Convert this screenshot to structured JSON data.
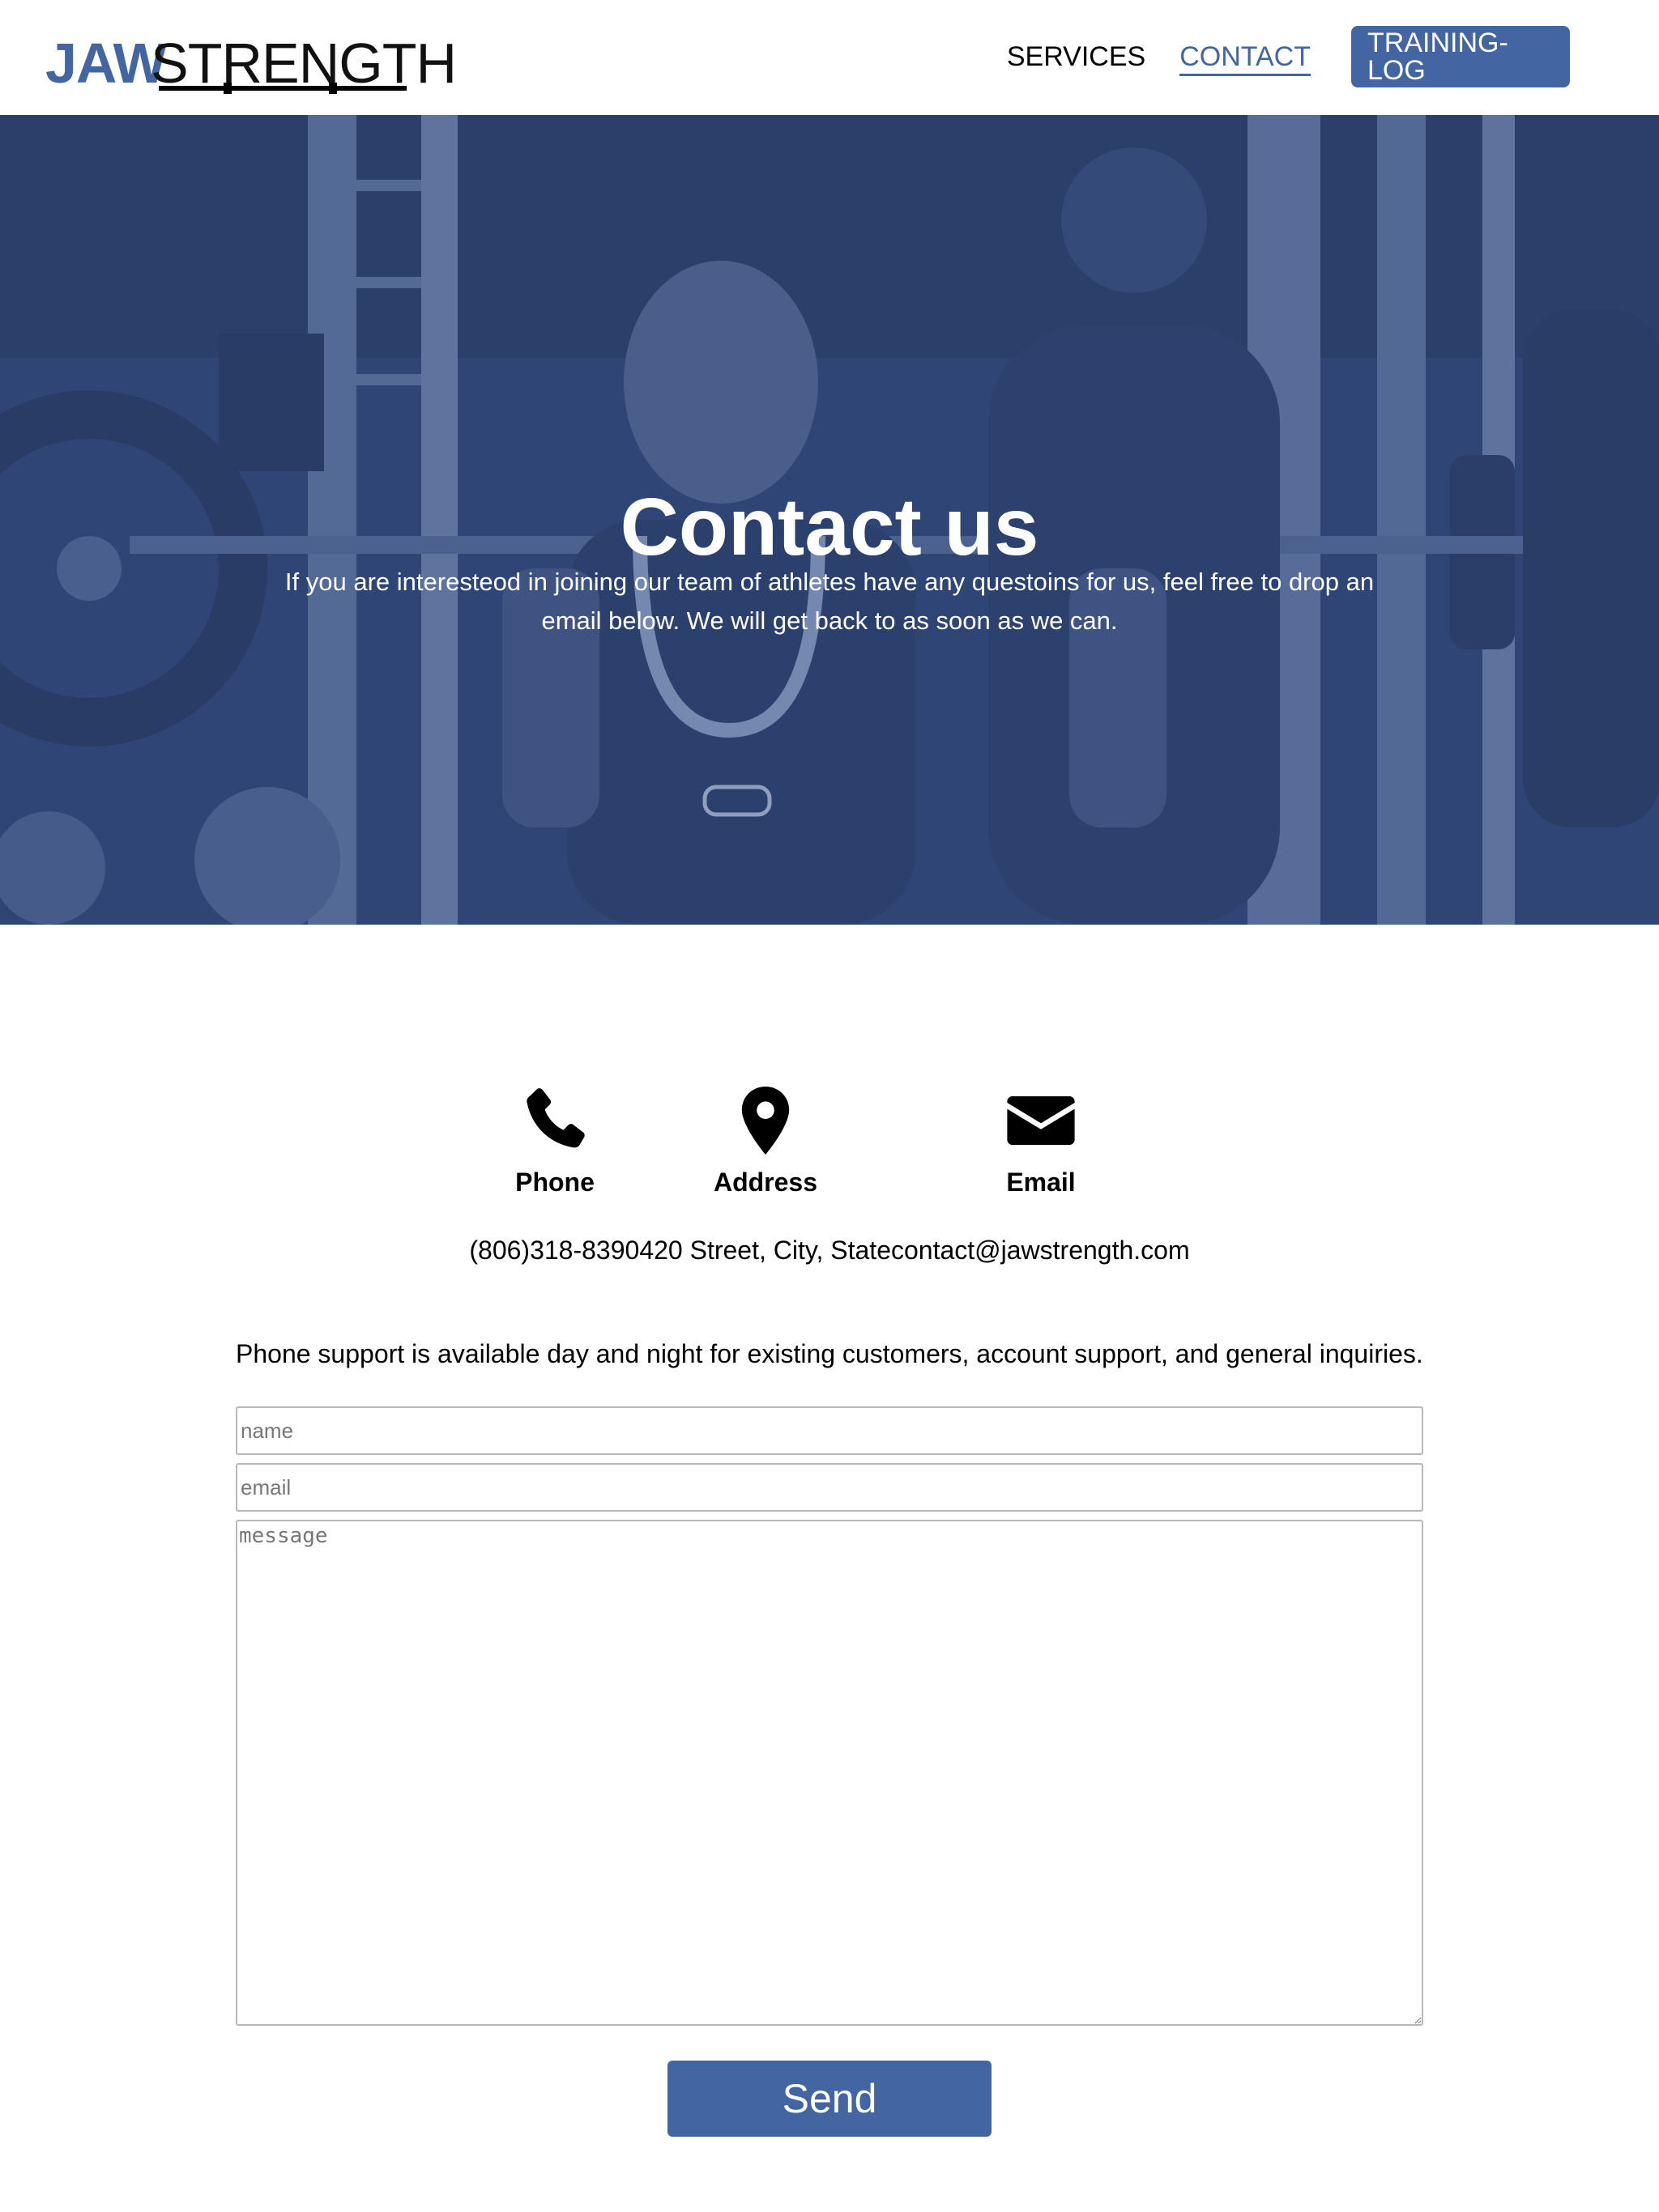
{
  "header": {
    "logo_jaw": "JAW",
    "logo_strength": "STRENGTH",
    "nav": {
      "services": "SERVICES",
      "contact": "CONTACT",
      "training_log": "TRAINING-LOG"
    }
  },
  "hero": {
    "title": "Contact us",
    "subtitle": "If you are interesteod in joining our team of athletes have any questoins for us, feel free to drop an email below. We will get back to as soon as we can."
  },
  "contact_info": {
    "phone_label": "Phone",
    "address_label": "Address",
    "email_label": "Email",
    "values_line": "(806)318-8390420 Street, City, Statecontact@jawstrength.com",
    "icons": [
      "phone-icon",
      "map-pin-icon",
      "envelope-icon"
    ]
  },
  "support_text": "Phone support is available day and night for existing customers, account support, and general inquiries.",
  "form": {
    "name_placeholder": "name",
    "email_placeholder": "email",
    "message_placeholder": "message",
    "send_label": "Send"
  },
  "colors": {
    "brand": "#4366a2",
    "hero_tint": "#2d416b"
  }
}
